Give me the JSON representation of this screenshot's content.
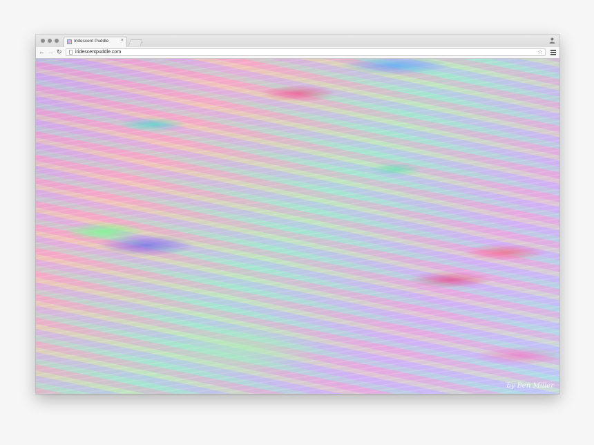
{
  "browser": {
    "tab": {
      "title": "Iridescent Puddle",
      "close_icon": "close-icon",
      "favicon": "iridescent-favicon"
    },
    "toolbar": {
      "back_icon": "back-arrow-icon",
      "forward_icon": "forward-arrow-icon",
      "reload_icon": "reload-icon",
      "url": "iridescentpuddle.com",
      "bookmark_icon": "star-icon",
      "menu_icon": "hamburger-menu-icon",
      "profile_icon": "user-icon"
    }
  },
  "page": {
    "signature": "by Ben Miller",
    "palette": [
      "#f2a6cf",
      "#a4e6cf",
      "#c9a8f0",
      "#f0e6a0",
      "#7af08c",
      "#6c5ce7"
    ]
  }
}
